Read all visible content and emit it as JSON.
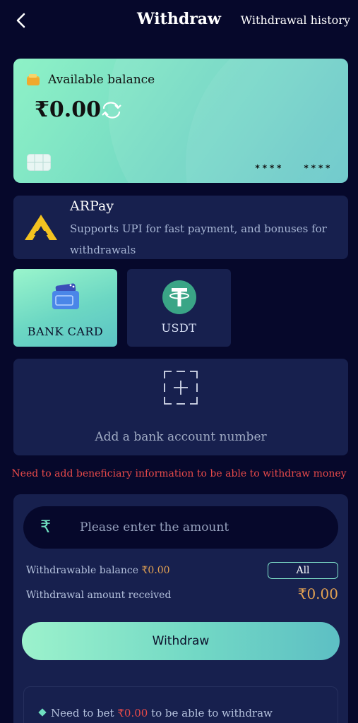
{
  "header": {
    "title": "Withdraw",
    "history_label": "Withdrawal history"
  },
  "balance": {
    "label": "Available balance",
    "amount": "₹0.00",
    "mask_left": "****",
    "mask_right": "****"
  },
  "arpay": {
    "name": "ARPay",
    "description": "Supports UPI for fast payment, and bonuses for withdrawals"
  },
  "methods": [
    {
      "label": "BANK CARD",
      "active": true,
      "icon": "bank-card-icon"
    },
    {
      "label": "USDT",
      "active": false,
      "icon": "usdt-icon"
    }
  ],
  "add_bank": {
    "label": "Add a bank account number"
  },
  "warning": "Need to add beneficiary information to be able to withdraw money",
  "form": {
    "currency_symbol": "₹",
    "amount_placeholder": "Please enter the amount",
    "withdrawable_label": "Withdrawable balance",
    "withdrawable_amount": "₹0.00",
    "all_label": "All",
    "received_label": "Withdrawal amount received",
    "received_amount": "₹0.00",
    "submit_label": "Withdraw"
  },
  "notes": {
    "prefix": "Need to bet",
    "amount": "₹0.00",
    "suffix": "to be able to withdraw"
  },
  "colors": {
    "background": "#06082b",
    "panel": "#17204e",
    "accent": "#7fe6c6",
    "gold": "#e5a352",
    "warning": "#e84a4a"
  }
}
